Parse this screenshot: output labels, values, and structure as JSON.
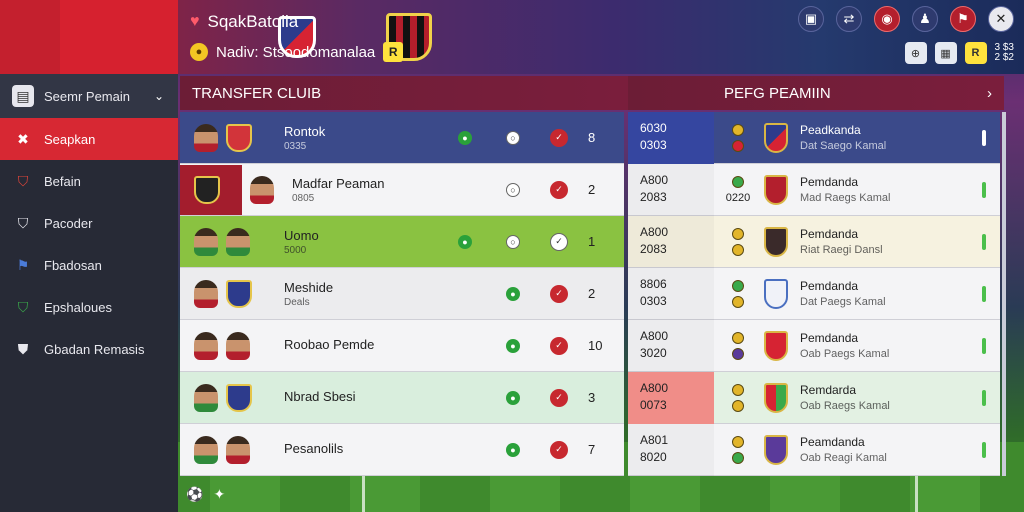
{
  "header": {
    "title": "SqakBatolia",
    "subtitle": "Nadiv: Stsoodomanalaa",
    "subtitle_badge": "R",
    "coin_icon": "coin-icon",
    "right_badge": "R",
    "right_text_top": "3 $3",
    "right_text_bottom": "2 $2"
  },
  "sidebar": {
    "header_label": "Seemr Pemain",
    "items": [
      {
        "label": "Seapkan",
        "icon": "shield-icon",
        "active": true
      },
      {
        "label": "Befain",
        "icon": "club-icon"
      },
      {
        "label": "Pacoder",
        "icon": "team-icon"
      },
      {
        "label": "Fbadosan",
        "icon": "flag-icon"
      },
      {
        "label": "Epshaloues",
        "icon": "crest-icon"
      },
      {
        "label": "Gbadan Remasis",
        "icon": "badge-icon"
      }
    ]
  },
  "left_panel": {
    "title": "TRANSFER CLUIB",
    "rows": [
      {
        "name": "Rontok",
        "sub": "0335",
        "count": "8"
      },
      {
        "name": "Madfar Peaman",
        "sub": "0805",
        "count": "2"
      },
      {
        "name": "Uomo",
        "sub": "5000",
        "count": "1"
      },
      {
        "name": "Meshide",
        "sub": "Deals",
        "count": "2"
      },
      {
        "name": "Roobao Pemde",
        "sub": "",
        "count": "10"
      },
      {
        "name": "Nbrad Sbesi",
        "sub": "",
        "count": "3"
      },
      {
        "name": "Pesanolils",
        "sub": "",
        "count": "7"
      }
    ]
  },
  "right_panel": {
    "title": "PEFG PEAMIIN",
    "rows": [
      {
        "v1": "6030",
        "v2": "0303",
        "name": "Peadkanda",
        "sub": "Dat Saego Kamal"
      },
      {
        "v1": "A800",
        "v2": "2083",
        "mid": "0220",
        "name": "Pemdanda",
        "sub": "Mad Raegs Kamal"
      },
      {
        "v1": "A800",
        "v2": "2083",
        "name": "Pemdanda",
        "sub": "Riat Raegi Dansl"
      },
      {
        "v1": "8806",
        "v2": "0303",
        "name": "Pemdanda",
        "sub": "Dat Paegs Kamal"
      },
      {
        "v1": "A800",
        "v2": "3020",
        "name": "Pemdanda",
        "sub": "Oab Paegs Kamal"
      },
      {
        "v1": "A800",
        "v2": "0073",
        "name": "Remdarda",
        "sub": "Oab Raegs Kamal"
      },
      {
        "v1": "A801",
        "v2": "8020",
        "name": "Peamdanda",
        "sub": "Oab Reagi Kamal"
      }
    ]
  }
}
